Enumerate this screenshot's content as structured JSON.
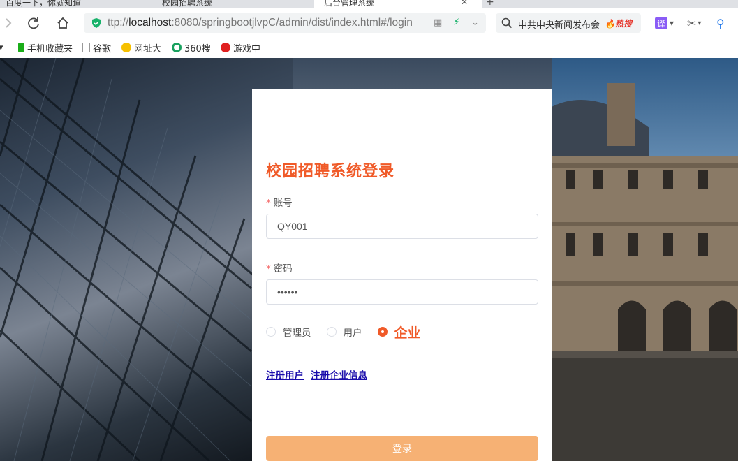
{
  "browser": {
    "tabs": [
      {
        "label": "百度一下，你就知道"
      },
      {
        "label": "校园招聘系统"
      },
      {
        "label": "后台管理系统",
        "active": true
      }
    ],
    "url": {
      "prefix": "ttp://",
      "host": "localhost",
      "rest": ":8080/springbootjlvpC/admin/dist/index.html#/login"
    },
    "search": {
      "text": "中共中央新闻发布会",
      "hot_label": "热搜"
    },
    "extensions": {
      "translate_label": "译"
    },
    "bookmarks": [
      {
        "label": "手机收藏夹",
        "icon": "phone-icon",
        "color": "#1aad19"
      },
      {
        "label": "谷歌",
        "icon": "page-icon",
        "color": "#999999"
      },
      {
        "label": "网址大",
        "icon": "globe-icon",
        "color": "#f6c000"
      },
      {
        "label": "360搜",
        "icon": "search-360-icon",
        "color": "#19a15f"
      },
      {
        "label": "游戏中",
        "icon": "game-icon",
        "color": "#e02020"
      }
    ]
  },
  "login": {
    "title": "校园招聘系统登录",
    "account_label": "账号",
    "account_value": "QY001",
    "password_label": "密码",
    "password_value": "••••••",
    "roles": [
      {
        "label": "管理员",
        "checked": false
      },
      {
        "label": "用户",
        "checked": false
      },
      {
        "label": "企业",
        "checked": true
      }
    ],
    "register_user": "注册用户",
    "register_company": "注册企业信息",
    "submit_label": "登录"
  },
  "colors": {
    "accent": "#f05a28",
    "button": "#f6b174",
    "link": "#1a0dab",
    "required": "#f56c6c"
  }
}
